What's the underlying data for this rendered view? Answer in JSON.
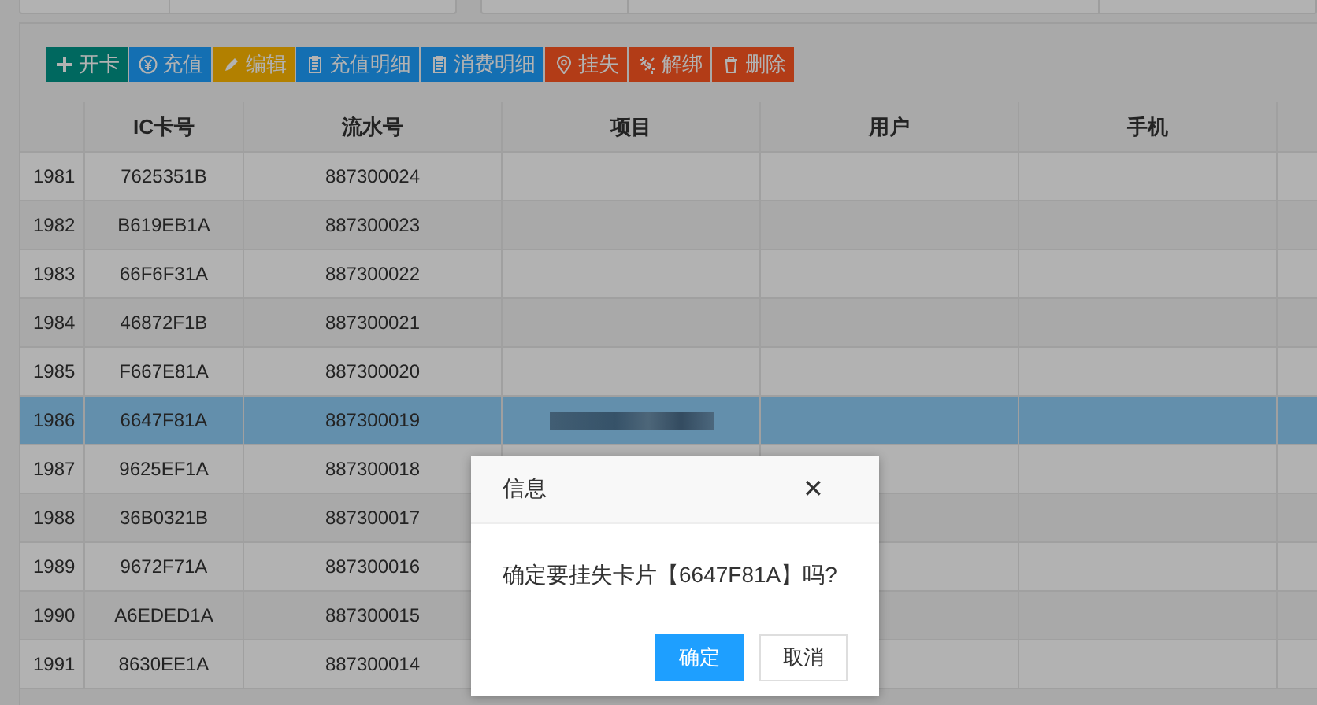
{
  "toolbar": [
    {
      "label": "开卡",
      "kind": "create"
    },
    {
      "label": "充值",
      "kind": "recharge"
    },
    {
      "label": "编辑",
      "kind": "edit"
    },
    {
      "label": "充值明细",
      "kind": "details"
    },
    {
      "label": "消费明细",
      "kind": "details"
    },
    {
      "label": "挂失",
      "kind": "report"
    },
    {
      "label": "解绑",
      "kind": "unbind"
    },
    {
      "label": "删除",
      "kind": "delete"
    }
  ],
  "table": {
    "columns": [
      "IC卡号",
      "流水号",
      "项目",
      "用户",
      "手机"
    ],
    "rows": [
      {
        "index": "1981",
        "card": "7625351B",
        "serial": "887300024",
        "selected": false,
        "redacted": false
      },
      {
        "index": "1982",
        "card": "B619EB1A",
        "serial": "887300023",
        "selected": false,
        "redacted": false
      },
      {
        "index": "1983",
        "card": "66F6F31A",
        "serial": "887300022",
        "selected": false,
        "redacted": false
      },
      {
        "index": "1984",
        "card": "46872F1B",
        "serial": "887300021",
        "selected": false,
        "redacted": false
      },
      {
        "index": "1985",
        "card": "F667E81A",
        "serial": "887300020",
        "selected": false,
        "redacted": false
      },
      {
        "index": "1986",
        "card": "6647F81A",
        "serial": "887300019",
        "selected": true,
        "redacted": true
      },
      {
        "index": "1987",
        "card": "9625EF1A",
        "serial": "887300018",
        "selected": false,
        "redacted": false
      },
      {
        "index": "1988",
        "card": "36B0321B",
        "serial": "887300017",
        "selected": false,
        "redacted": false
      },
      {
        "index": "1989",
        "card": "9672F71A",
        "serial": "887300016",
        "selected": false,
        "redacted": false
      },
      {
        "index": "1990",
        "card": "A6EDED1A",
        "serial": "887300015",
        "selected": false,
        "redacted": false
      },
      {
        "index": "1991",
        "card": "8630EE1A",
        "serial": "887300014",
        "selected": false,
        "redacted": false
      }
    ]
  },
  "dialog": {
    "title": "信息",
    "close": "✕",
    "message": "确定要挂失卡片【6647F81A】吗?",
    "buttons": [
      {
        "label": "确定",
        "kind": "primary"
      },
      {
        "label": "取消",
        "kind": "default"
      }
    ]
  }
}
